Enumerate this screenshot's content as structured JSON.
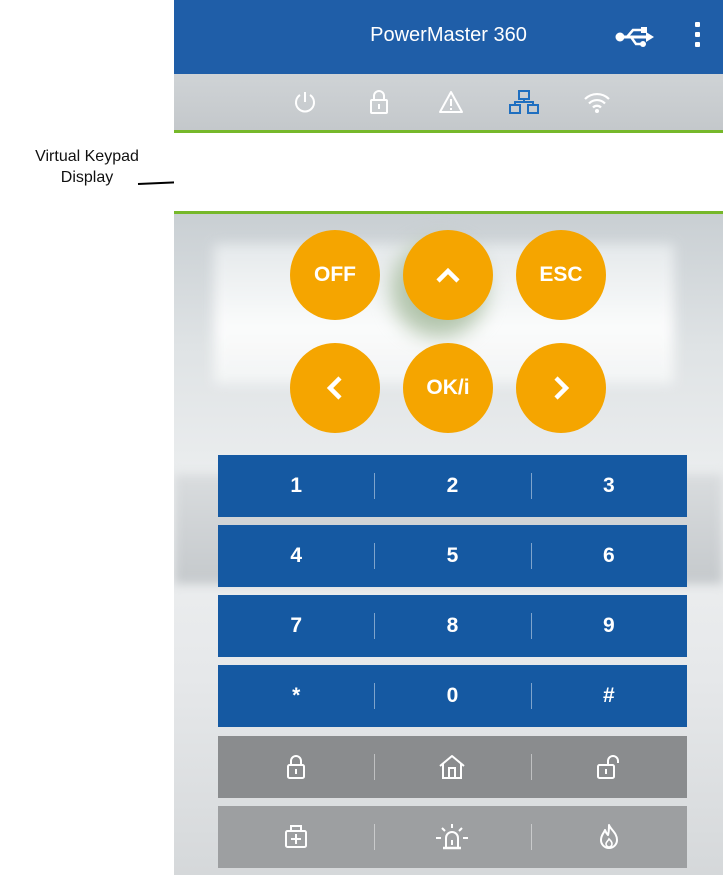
{
  "annotation": {
    "line1": "Virtual Keypad",
    "line2": "Display"
  },
  "app": {
    "title": "PowerMaster 360",
    "header_icons": [
      "usb-icon",
      "more-vert-icon"
    ]
  },
  "status_icons": [
    "power-icon",
    "lock-icon",
    "warning-icon",
    "network-icon",
    "wifi-icon"
  ],
  "colors": {
    "appbar": "#1f5ea8",
    "accent_green": "#76b82a",
    "orange_button": "#f5a500",
    "key_blue": "#1559a2",
    "key_gray": "#8a8c8e",
    "active_status_icon": "#1f6fc0"
  },
  "nav_buttons": {
    "off": "OFF",
    "up": "up-chevron-icon",
    "esc": "ESC",
    "left": "left-chevron-icon",
    "ok": "OK/i",
    "right": "right-chevron-icon"
  },
  "keypad": {
    "rows": [
      [
        "1",
        "2",
        "3"
      ],
      [
        "4",
        "5",
        "6"
      ],
      [
        "7",
        "8",
        "9"
      ],
      [
        "*",
        "0",
        "#"
      ]
    ],
    "arm_row": [
      "arm-away-lock-icon",
      "arm-home-icon",
      "disarm-unlock-icon"
    ],
    "emergency_row": [
      "medical-emergency-icon",
      "panic-siren-icon",
      "fire-icon"
    ]
  }
}
